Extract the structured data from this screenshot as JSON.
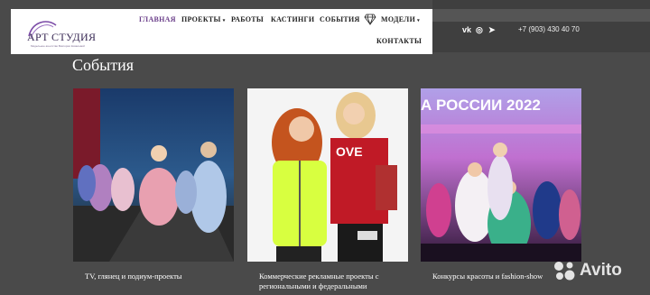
{
  "header": {
    "logo_text": "АРТ СТУДИЯ",
    "logo_subtext": "Модельное агентство Виктории Ковалевой",
    "nav": [
      {
        "label": "ГЛАВНАЯ",
        "active": true
      },
      {
        "label": "ПРОЕКТЫ",
        "dropdown": true
      },
      {
        "label": "РАБОТЫ"
      },
      {
        "label": "КАСТИНГИ"
      },
      {
        "label": "СОБЫТИЯ"
      },
      {
        "label": "МОДЕЛИ",
        "dropdown": true,
        "icon": "diamond-icon"
      },
      {
        "label": "КОНТАКТЫ"
      }
    ],
    "caret": "▾"
  },
  "contacts": {
    "social_icons": [
      "vk-icon",
      "whatsapp-icon",
      "telegram-icon"
    ],
    "social_glyphs": {
      "vk": "vk",
      "whatsapp": "◎",
      "telegram": "➤"
    },
    "phone": "+7 (903) 430 40 70"
  },
  "page": {
    "title": "События"
  },
  "cards": [
    {
      "caption": "TV, глянец и подиум-проекты",
      "image": "runway-show-photo"
    },
    {
      "caption": "Коммерческие рекламные проекты с региональными и федеральными",
      "image": "kids-fashion-ad-photo"
    },
    {
      "caption": "Конкурсы красоты и fashion-show",
      "image": "beauty-contest-photo"
    }
  ],
  "watermark": {
    "text": "Avito"
  },
  "colors": {
    "background": "#4a4a4a",
    "header_bg": "#ffffff",
    "nav_active": "#6b3f8a",
    "nav_text": "#222222"
  }
}
